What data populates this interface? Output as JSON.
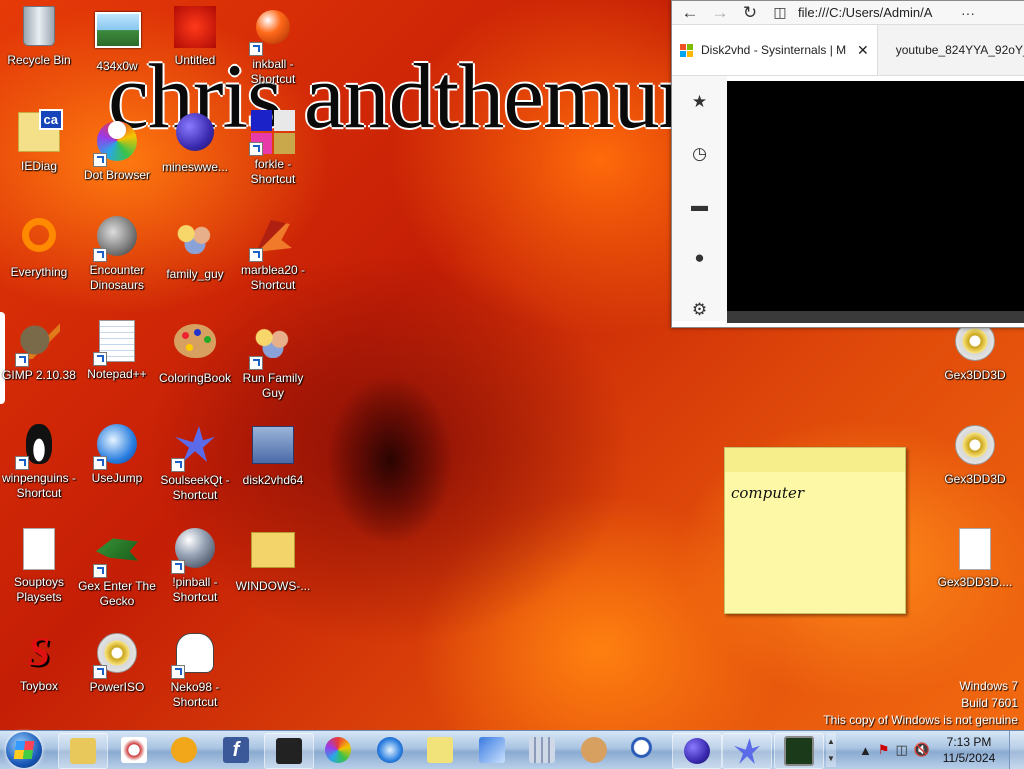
{
  "wallpaper": {
    "title": "chris andthemur"
  },
  "desktop_icons": [
    {
      "label": "Recycle Bin"
    },
    {
      "label": "434x0w"
    },
    {
      "label": "Untitled"
    },
    {
      "label": "inkball - Shortcut"
    },
    {
      "label": "IEDiag"
    },
    {
      "label": "Dot Browser"
    },
    {
      "label": "mineswwe..."
    },
    {
      "label": "forkle - Shortcut"
    },
    {
      "label": "Everything"
    },
    {
      "label": "Encounter Dinosaurs"
    },
    {
      "label": "family_guy"
    },
    {
      "label": "marblea20 - Shortcut"
    },
    {
      "label": "GIMP 2.10.38"
    },
    {
      "label": "Notepad++"
    },
    {
      "label": "ColoringBook"
    },
    {
      "label": "Run Family Guy"
    },
    {
      "label": "winpenguins - Shortcut"
    },
    {
      "label": "UseJump"
    },
    {
      "label": "SoulseekQt - Shortcut"
    },
    {
      "label": "disk2vhd64"
    },
    {
      "label": "Souptoys Playsets"
    },
    {
      "label": "Gex Enter The Gecko"
    },
    {
      "label": "!pinball - Shortcut"
    },
    {
      "label": "WINDOWS-..."
    },
    {
      "label": "Toybox"
    },
    {
      "label": "PowerISO"
    },
    {
      "label": "Neko98 - Shortcut"
    }
  ],
  "right_icons": [
    {
      "label": "Gex3DD3D"
    },
    {
      "label": "Gex3DD3D"
    },
    {
      "label": "Gex3DD3D...."
    }
  ],
  "browser": {
    "url": "file:///C:/Users/Admin/A",
    "more": "···",
    "tabs": [
      {
        "title": "Disk2vhd - Sysinternals | M"
      },
      {
        "title": "youtube_824YYA_92oY_"
      }
    ],
    "side_icons": [
      "star-icon",
      "history-icon",
      "hat-icon",
      "account-icon",
      "settings-icon"
    ]
  },
  "sticky_note": {
    "text": "computer"
  },
  "watermark": {
    "line1": "Windows 7",
    "line2": "Build 7601",
    "line3": "This copy of Windows is not genuine"
  },
  "taskbar": {
    "time": "7:13 PM",
    "date": "11/5/2024",
    "pinned": [
      "explorer",
      "snipping-tool",
      "media-player",
      "facebook",
      "app-dark",
      "dot-browser",
      "usejump",
      "folder-app",
      "network-app",
      "calculator",
      "paint",
      "magnifier",
      "minesweeper",
      "soulseek",
      "terminal"
    ]
  }
}
